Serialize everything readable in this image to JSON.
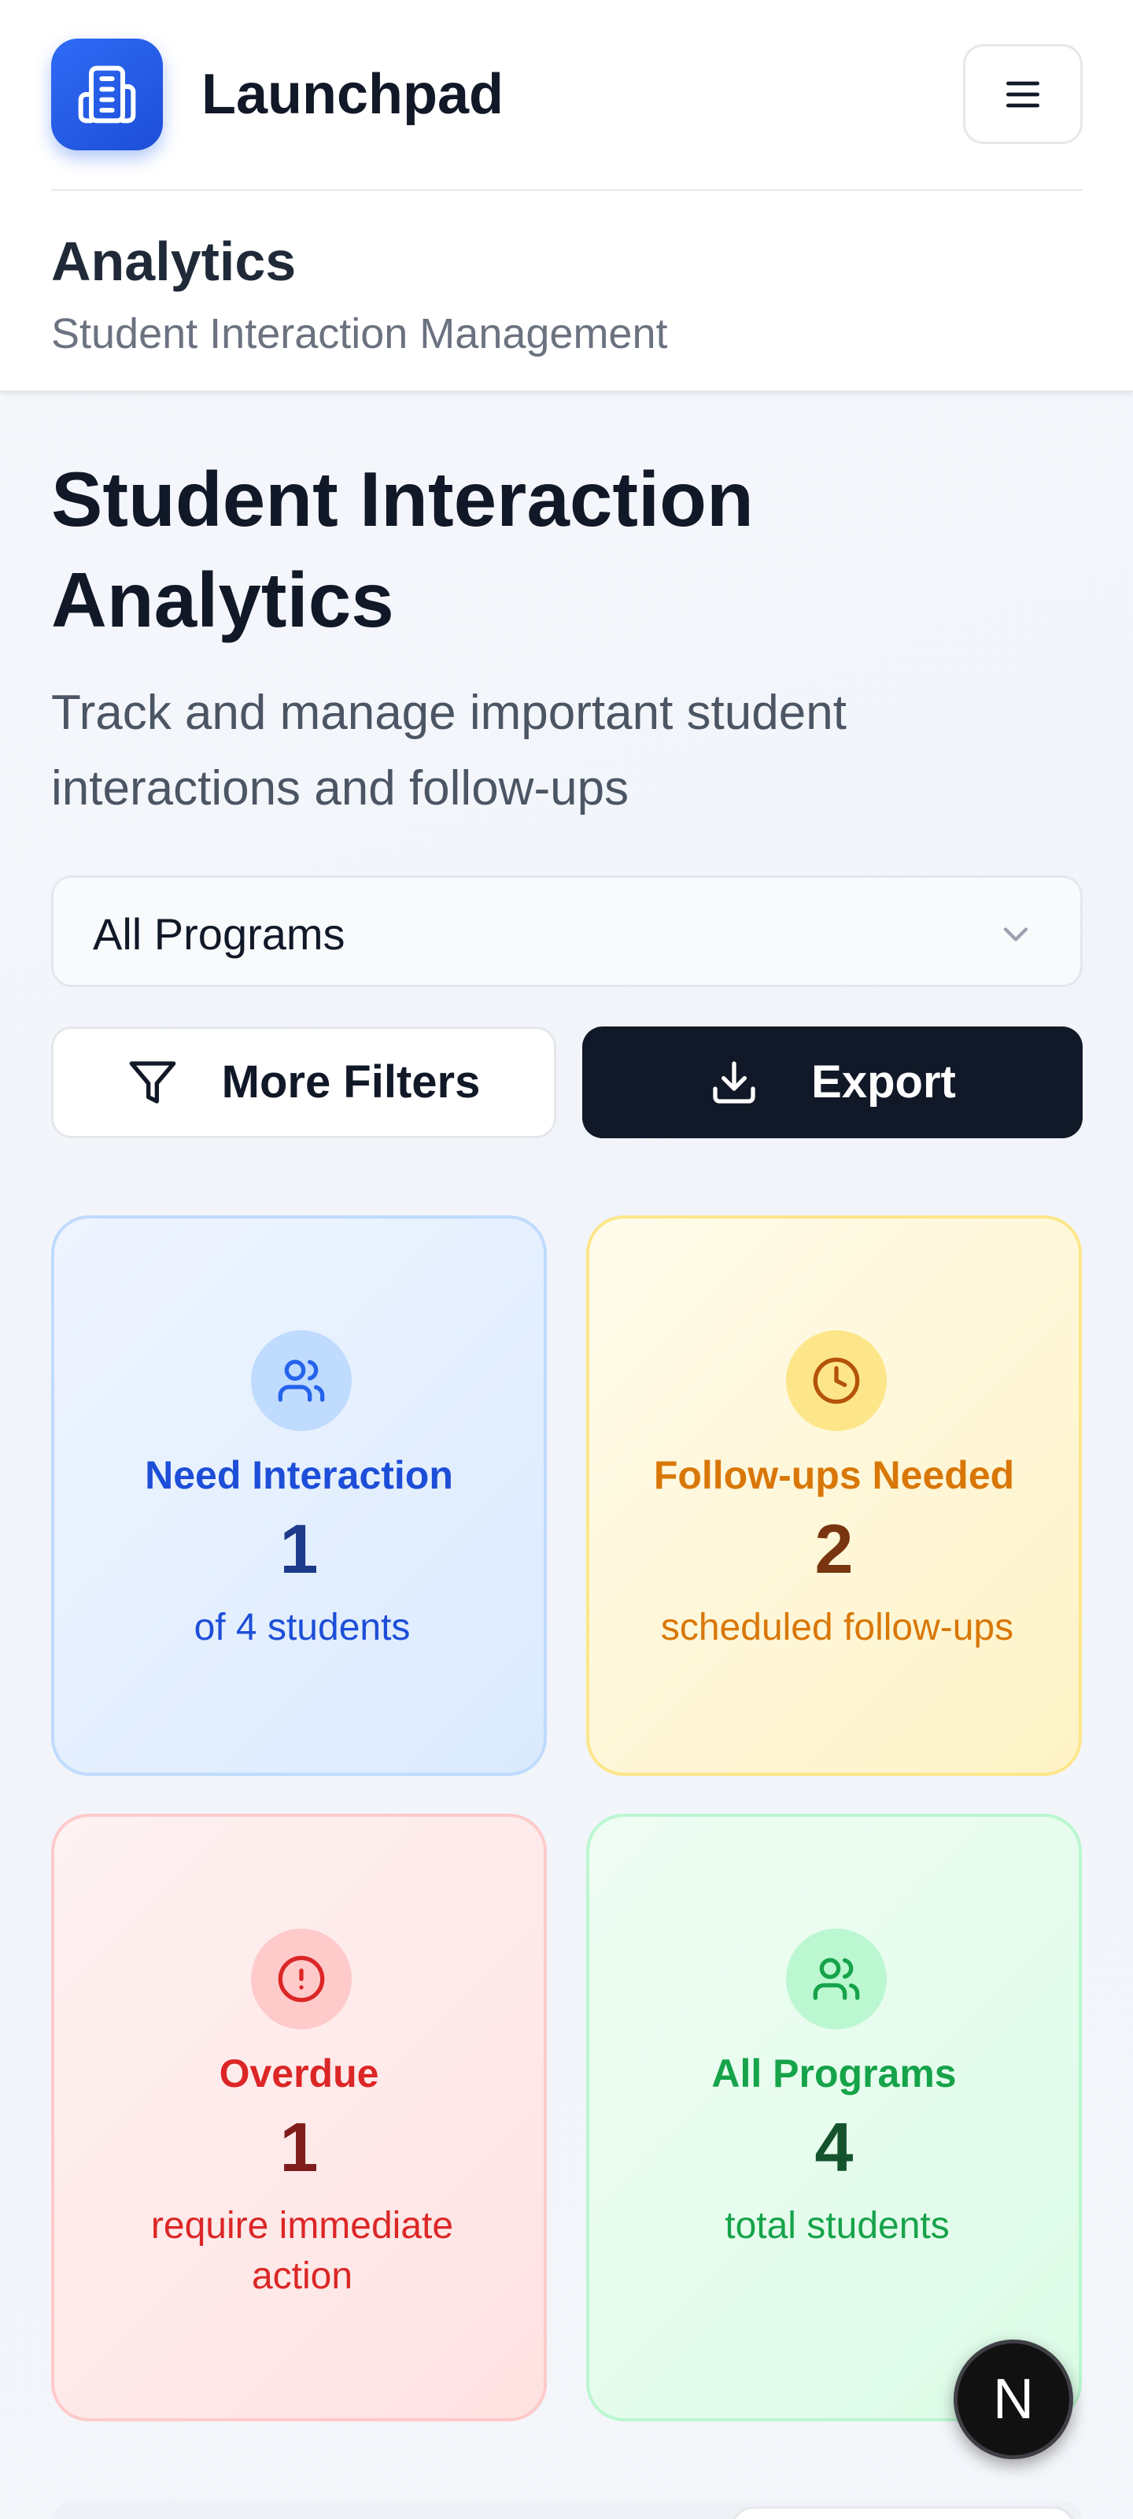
{
  "app": {
    "brand": "Launchpad"
  },
  "header": {
    "section_title": "Analytics",
    "section_subtitle": "Student Interaction Management"
  },
  "page": {
    "title": "Student Interaction Analytics",
    "description": "Track and manage important student interactions and follow-ups"
  },
  "filters": {
    "program_select_value": "All Programs",
    "more_filters_label": "More Filters",
    "export_label": "Export"
  },
  "stats": [
    {
      "label": "Need Interaction",
      "value": "1",
      "sub": "of 4 students",
      "icon": "users-icon",
      "color": "#1d4ed8"
    },
    {
      "label": "Follow-ups Needed",
      "value": "2",
      "sub": "scheduled follow-ups",
      "icon": "clock-icon",
      "color": "#d97706"
    },
    {
      "label": "Overdue",
      "value": "1",
      "sub": "require immediate action",
      "icon": "alert-circle-icon",
      "color": "#dc2626"
    },
    {
      "label": "All Programs",
      "value": "4",
      "sub": "total students",
      "icon": "users-icon",
      "color": "#16a34a"
    }
  ],
  "floating_badge": {
    "letter": "N"
  },
  "colors": {
    "brand_blue": "#2563eb",
    "export_bg": "#111827"
  }
}
